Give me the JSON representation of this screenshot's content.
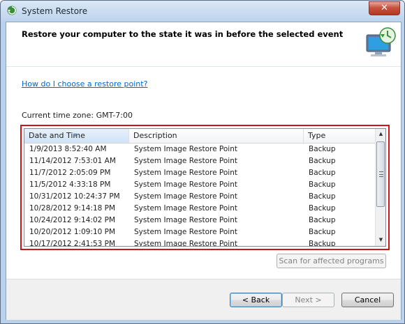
{
  "window": {
    "title": "System Restore",
    "close_glyph": "✕"
  },
  "header": {
    "heading": "Restore your computer to the state it was in before the selected event",
    "icon": "system-restore-icon"
  },
  "help_link": "How do I choose a restore point?",
  "timezone_label": "Current time zone: GMT-7:00",
  "list": {
    "columns": [
      "Date and Time",
      "Description",
      "Type"
    ],
    "sorted_column": "Date and Time",
    "rows": [
      [
        "1/9/2013 8:52:40 AM",
        "System Image Restore Point",
        "Backup"
      ],
      [
        "11/14/2012 7:53:01 AM",
        "System Image Restore Point",
        "Backup"
      ],
      [
        "11/7/2012 2:05:09 PM",
        "System Image Restore Point",
        "Backup"
      ],
      [
        "11/5/2012 4:33:18 PM",
        "System Image Restore Point",
        "Backup"
      ],
      [
        "10/31/2012 10:24:37 PM",
        "System Image Restore Point",
        "Backup"
      ],
      [
        "10/28/2012 9:14:18 PM",
        "System Image Restore Point",
        "Backup"
      ],
      [
        "10/24/2012 9:14:02 PM",
        "System Image Restore Point",
        "Backup"
      ],
      [
        "10/20/2012 1:09:10 PM",
        "System Image Restore Point",
        "Backup"
      ],
      [
        "10/17/2012 2:41:53 PM",
        "System Image Restore Point",
        "Backup"
      ]
    ],
    "highlight_color": "#d1131b"
  },
  "buttons": {
    "scan": "Scan for affected programs",
    "back": "< Back",
    "next": "Next >",
    "cancel": "Cancel"
  }
}
